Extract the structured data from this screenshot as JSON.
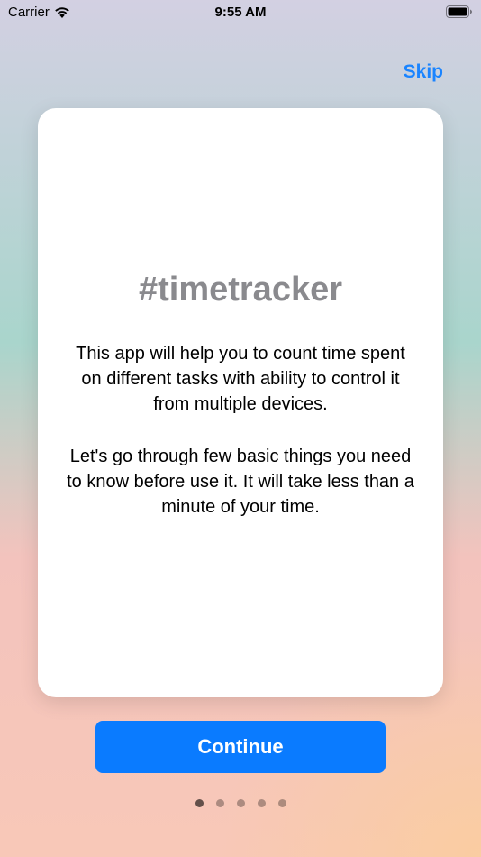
{
  "status_bar": {
    "carrier": "Carrier",
    "time": "9:55 AM",
    "wifi_icon": "wifi-icon",
    "battery_icon": "battery-icon"
  },
  "header": {
    "skip_label": "Skip"
  },
  "card": {
    "title": "#timetracker",
    "paragraph1": "This app will help you to count time spent on different tasks with ability to control it from multiple devices.",
    "paragraph2": "Let's go through few basic things you need to know before use it. It will take less than a minute of your time."
  },
  "continue_label": "Continue",
  "pagination": {
    "total_pages": 5,
    "current_page": 1
  },
  "colors": {
    "accent": "#0a7bff",
    "skip_text": "#1a84ff",
    "title_gray": "#8a8a8e"
  }
}
